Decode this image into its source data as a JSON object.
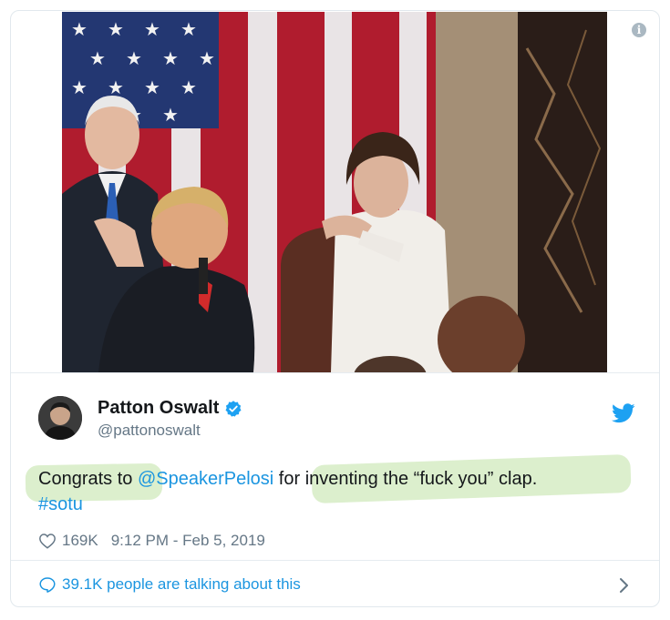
{
  "embed": {
    "info_icon": "info-icon",
    "media_alt": "Photo: applause at the State of the Union"
  },
  "author": {
    "name": "Patton Oswalt",
    "handle": "@pattonoswalt",
    "verified": true
  },
  "tweet": {
    "prefix": "Congrats to ",
    "mention": "@SpeakerPelosi",
    "suffix": " for inventing the “fuck you” clap.",
    "hashtag": "#sotu"
  },
  "meta": {
    "likes": "169K",
    "timestamp": "9:12 PM - Feb 5, 2019"
  },
  "footer": {
    "talking": "39.1K people are talking about this"
  },
  "colors": {
    "link": "#1b95e0",
    "highlight": "#d6ecc4",
    "muted": "#657786"
  }
}
